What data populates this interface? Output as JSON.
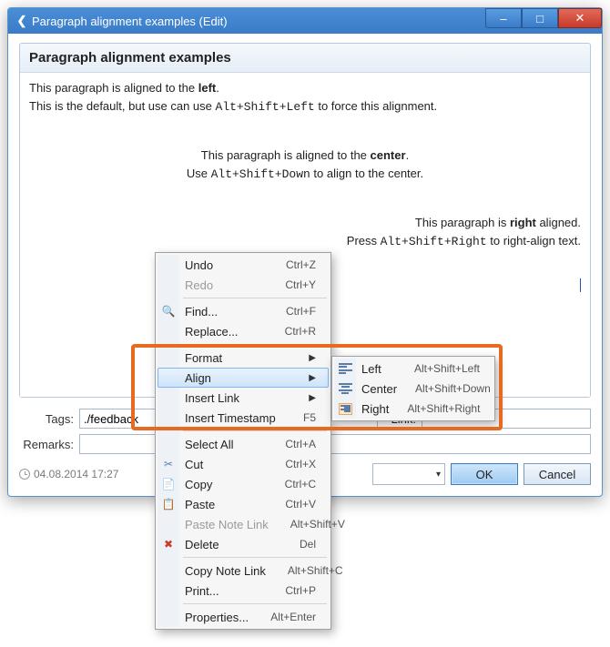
{
  "window": {
    "title": "Paragraph alignment examples (Edit)"
  },
  "panel": {
    "title": "Paragraph alignment examples"
  },
  "editor": {
    "p1_a": "This paragraph is aligned to the ",
    "p1_b": "left",
    "p1_c": ".",
    "p2_a": "This is the default, but use can use ",
    "p2_code": "Alt+Shift+Left",
    "p2_b": " to force this alignment.",
    "p3_a": "This paragraph is aligned to the ",
    "p3_b": "center",
    "p3_c": ".",
    "p4_a": "Use ",
    "p4_code": "Alt+Shift+Down",
    "p4_b": " to align to the center.",
    "p5_a": "This paragraph is ",
    "p5_b": "right",
    "p5_c": " aligned.",
    "p6_a": "Press ",
    "p6_code": "Alt+Shift+Right",
    "p6_b": " to right-align text."
  },
  "fields": {
    "tags_label": "Tags:",
    "tags_value": "./feedback",
    "link_label": "Link:",
    "link_value": "",
    "remarks_label": "Remarks:",
    "remarks_value": ""
  },
  "footer": {
    "timestamp": "04.08.2014 17:27",
    "ok": "OK",
    "cancel": "Cancel"
  },
  "context_menu": {
    "undo": "Undo",
    "undo_sc": "Ctrl+Z",
    "redo": "Redo",
    "redo_sc": "Ctrl+Y",
    "find": "Find...",
    "find_sc": "Ctrl+F",
    "replace": "Replace...",
    "replace_sc": "Ctrl+R",
    "format": "Format",
    "align": "Align",
    "insert_link": "Insert Link",
    "insert_ts": "Insert Timestamp",
    "insert_ts_sc": "F5",
    "select_all": "Select All",
    "select_all_sc": "Ctrl+A",
    "cut": "Cut",
    "cut_sc": "Ctrl+X",
    "copy": "Copy",
    "copy_sc": "Ctrl+C",
    "paste": "Paste",
    "paste_sc": "Ctrl+V",
    "paste_note": "Paste Note Link",
    "paste_note_sc": "Alt+Shift+V",
    "delete": "Delete",
    "delete_sc": "Del",
    "copy_note": "Copy Note Link",
    "copy_note_sc": "Alt+Shift+C",
    "print": "Print...",
    "print_sc": "Ctrl+P",
    "properties": "Properties...",
    "properties_sc": "Alt+Enter"
  },
  "align_submenu": {
    "left": "Left",
    "left_sc": "Alt+Shift+Left",
    "center": "Center",
    "center_sc": "Alt+Shift+Down",
    "right": "Right",
    "right_sc": "Alt+Shift+Right"
  }
}
